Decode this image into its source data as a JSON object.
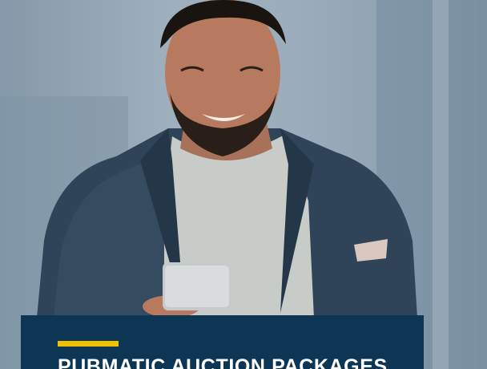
{
  "panel": {
    "headline": "PUBMATIC AUCTION PACKAGES",
    "accent_color": "#f2c200",
    "background_color": "#0d3554"
  },
  "photo": {
    "subject": "smiling man in grey blazer looking at smartphone"
  }
}
